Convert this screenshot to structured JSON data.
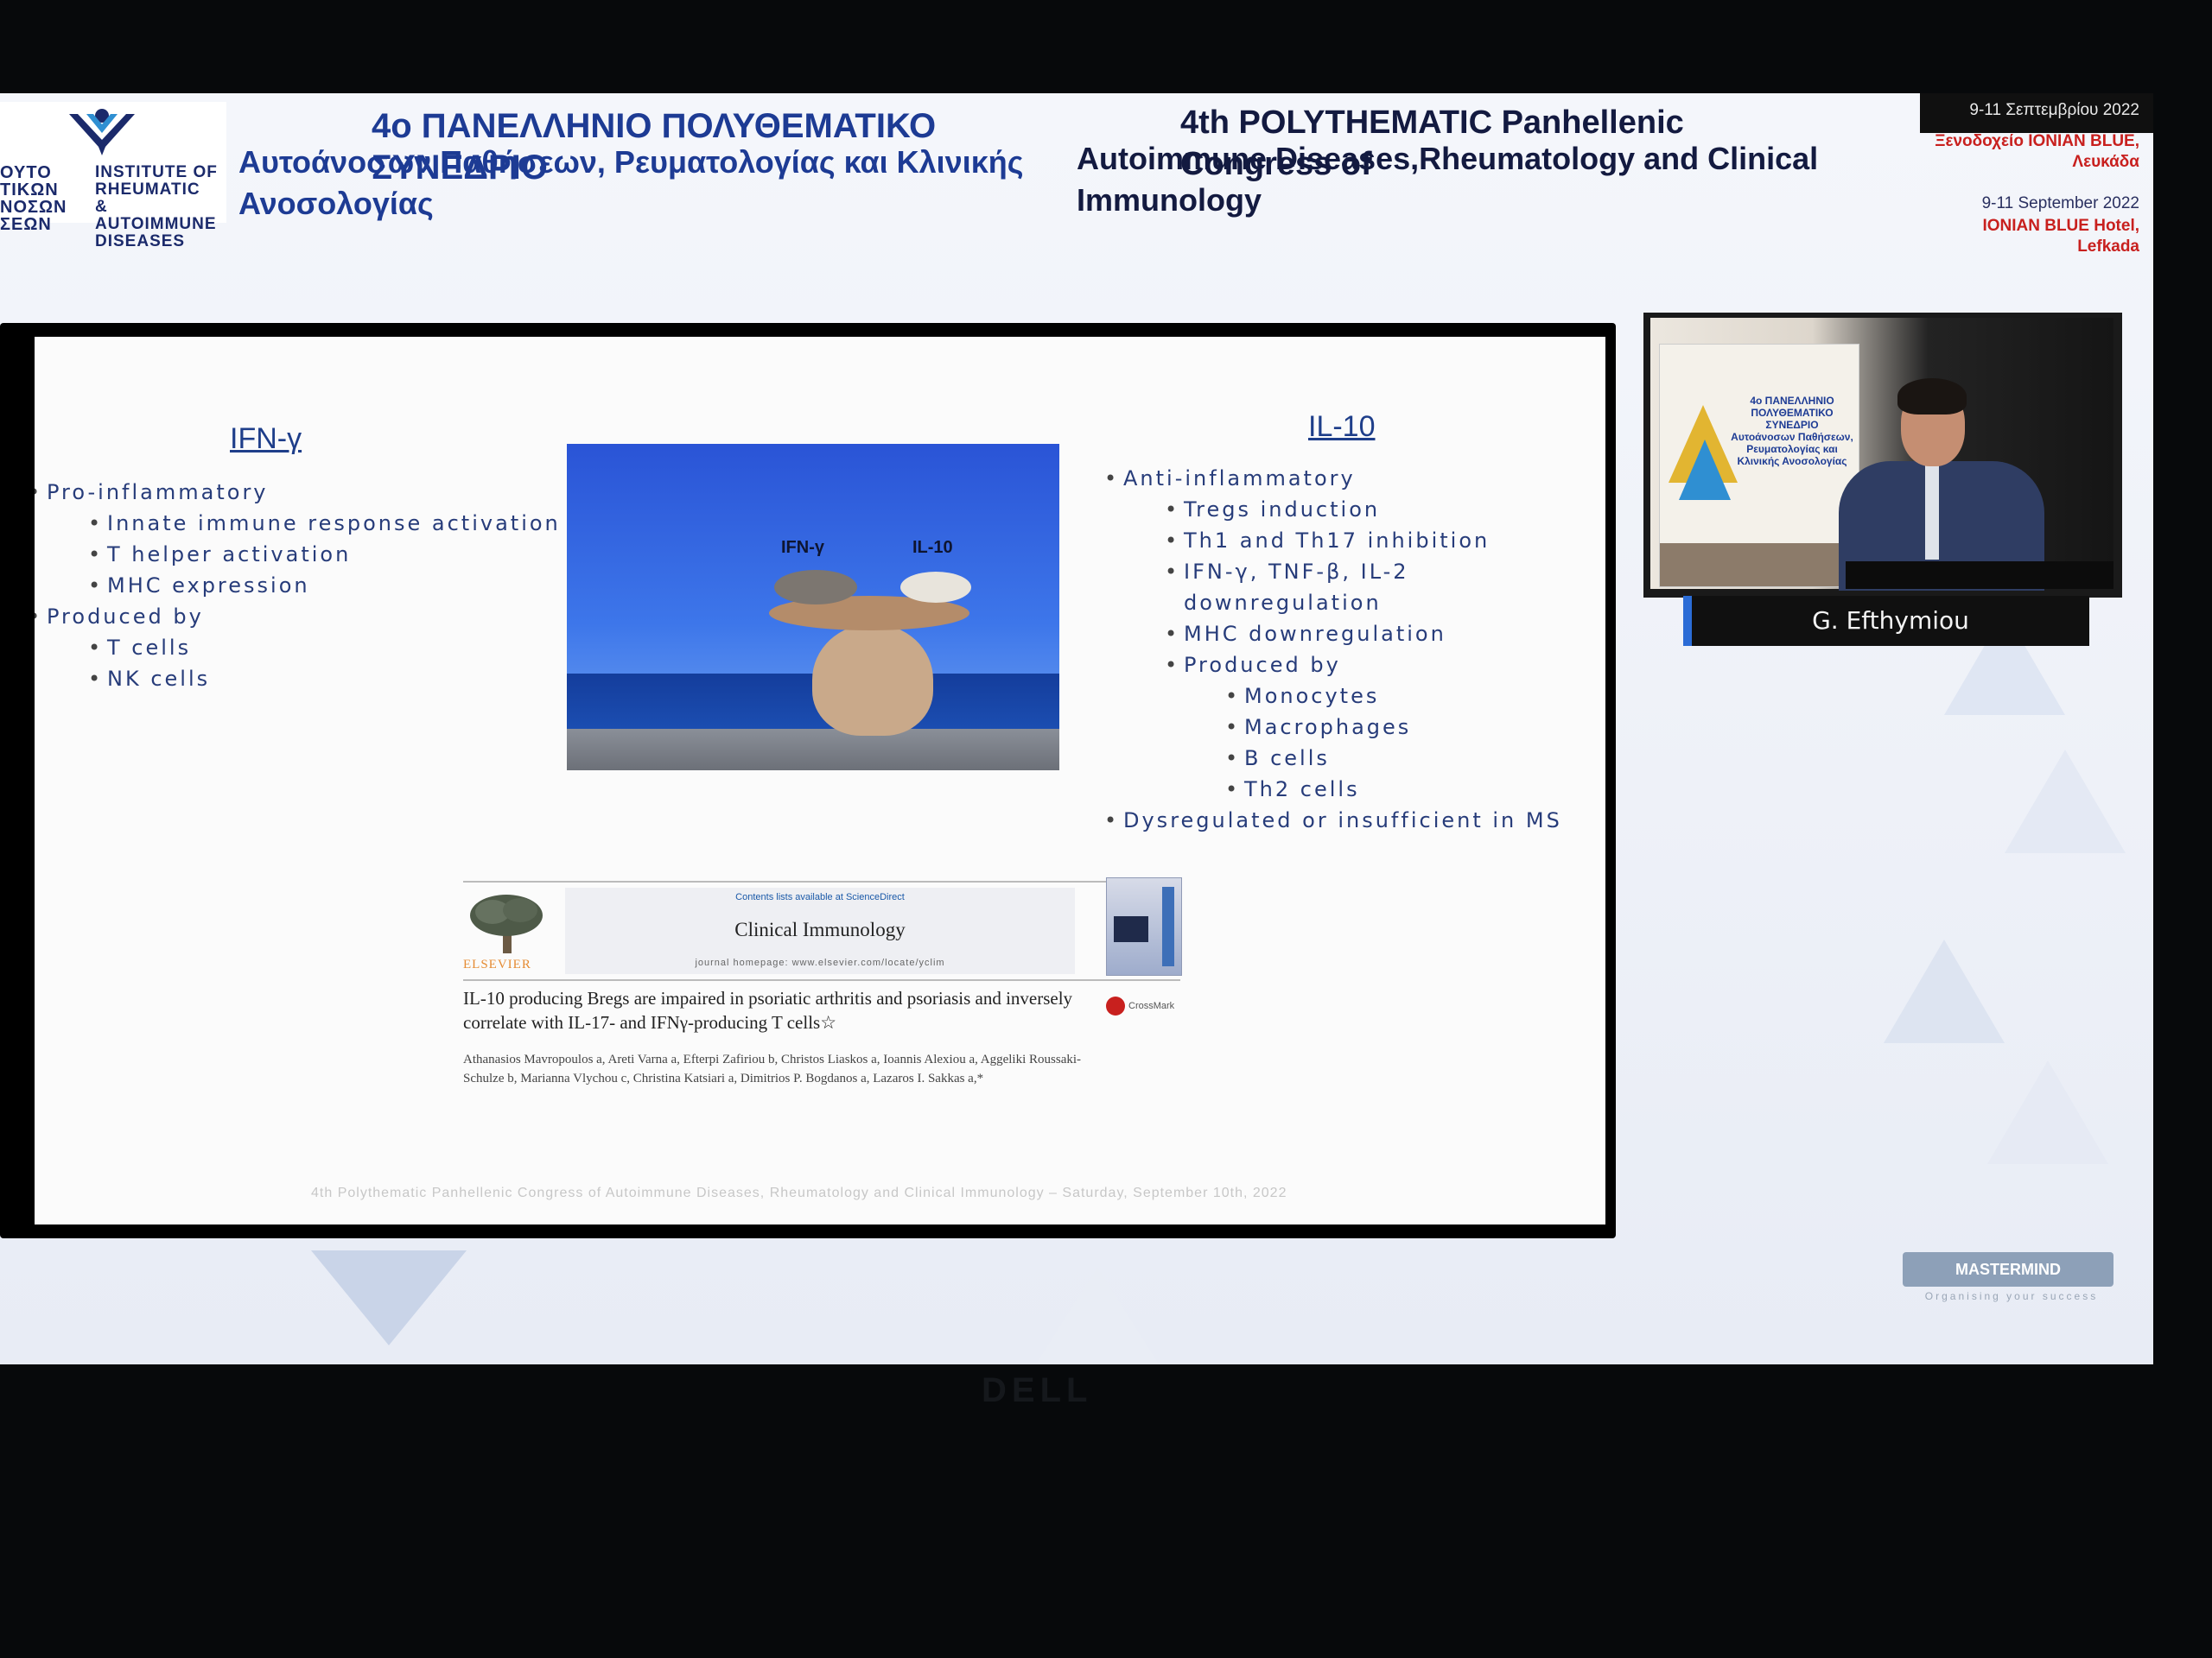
{
  "header": {
    "logo_gr": "ΟΥΤΟ\nΤΙΚΩΝ\nΝΟΣΩΝ\nΣΕΩΝ",
    "logo_en": "INSTITUTE OF\nRHEUMATIC\n& AUTOIMMUNE\nDISEASES",
    "title_gr_line1": "4ο ΠΑΝΕΛΛΗΝΙΟ ΠΟΛΥΘΕΜΑΤΙΚΟ ΣΥΝΕΔΡΙΟ",
    "title_gr_line2": "Αυτοάνοσων Παθήσεων, Ρευματολογίας και Κλινικής Ανοσολογίας",
    "title_en_line1": "4th POLYTHEMATIC Panhellenic Congress of",
    "title_en_line2": "Autoimmune Diseases,Rheumatology and Clinical Immunology",
    "venue_gr_dates": "9-11 Σεπτεμβρίου 2022",
    "venue_gr_hotel": "Ξενοδοχείο IONIAN BLUE,",
    "venue_gr_city": "Λευκάδα",
    "venue_en_dates": "9-11 September 2022",
    "venue_en_hotel": "IONIAN BLUE Hotel,",
    "venue_en_city": "Lefkada"
  },
  "slide": {
    "left_title": "IFN-γ",
    "left_bullets": [
      "Pro-inflammatory",
      "Innate immune response activation",
      "T helper activation",
      "MHC expression",
      "Produced by",
      "T cells",
      "NK cells"
    ],
    "right_title": "IL-10",
    "right_bullets": [
      "Anti-inflammatory",
      "Tregs induction",
      "Th1 and Th17 inhibition",
      "IFN-γ, TNF-β, IL-2 downregulation",
      "MHC downregulation",
      "Produced by",
      "Monocytes",
      "Macrophages",
      "B cells",
      "Th2 cells",
      "Dysregulated or insufficient in MS"
    ],
    "photo_label_left": "IFN-γ",
    "photo_label_right": "IL-10",
    "journal": {
      "contents_available": "Contents lists available at ScienceDirect",
      "name": "Clinical Immunology",
      "homepage": "journal homepage: www.elsevier.com/locate/yclim",
      "publisher": "ELSEVIER",
      "crossmark": "CrossMark",
      "article_title": "IL-10 producing Bregs are impaired in psoriatic arthritis and psoriasis and inversely correlate with IL-17- and IFNγ-producing T cells☆",
      "authors": "Athanasios Mavropoulos a, Areti Varna a, Efterpi Zafiriou b, Christos Liaskos a, Ioannis Alexiou a, Aggeliki Roussaki-Schulze b, Marianna Vlychou c, Christina Katsiari a, Dimitrios P. Bogdanos a, Lazaros I. Sakkas a,*"
    },
    "footer": "4th Polythematic Panhellenic Congress of Autoimmune Diseases, Rheumatology and Clinical Immunology – Saturday, September 10th, 2022"
  },
  "video": {
    "poster_text": "4ο ΠΑΝΕΛΛΗΝΙΟ\nΠΟΛΥΘΕΜΑΤΙΚΟ ΣΥΝΕΔΡΙΟ\nΑυτοάνοσων Παθήσεων,\nΡευματολογίας και\nΚλινικής Ανοσολογίας",
    "speaker_name": "G. Efthymiou"
  },
  "branding": {
    "mastermind": "MASTERMIND",
    "mastermind_sub": "Organising your success",
    "monitor_brand": "DELL"
  },
  "colors": {
    "title_blue": "#1d3b94",
    "venue_red": "#c8201e",
    "bullet_text": "#273c7a"
  }
}
